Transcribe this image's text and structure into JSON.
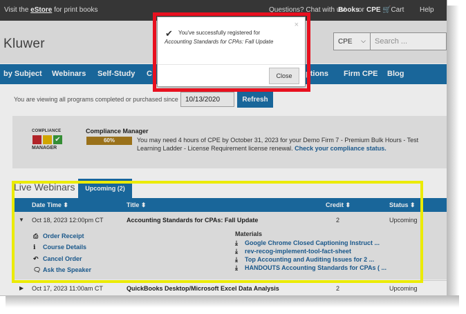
{
  "topbar": {
    "estore_pre": "Visit the ",
    "estore_link": "eStore",
    "estore_post": " for print books",
    "questions": "Questions? Chat with us!",
    "books": "Books",
    "or": "or",
    "cpe": "CPE",
    "cart": "Cart",
    "help": "Help"
  },
  "header": {
    "logo": "Kluwer",
    "cpe_select": "CPE",
    "search_placeholder": "Search ..."
  },
  "nav": {
    "items": [
      "by Subject",
      "Webinars",
      "Self-Study",
      "C",
      "ptions",
      "Firm CPE",
      "Blog"
    ]
  },
  "filter": {
    "label": "You are viewing all programs completed or purchased since",
    "date": "10/13/2020",
    "refresh": "Refresh"
  },
  "compliance": {
    "logo_top": "COMPLIANCE",
    "logo_bottom": "MANAGER",
    "title": "Compliance Manager",
    "progress": "60%",
    "progress_value": 0.6,
    "text": "You may need 4 hours of CPE by October 31, 2023 for your Demo Firm 7 - Premium Bulk Hours - Test Learning Ladder - License Requirement license renewal.",
    "link": "Check your compliance status."
  },
  "webinars": {
    "title": "Live Webinars",
    "tab": "Upcoming (2)",
    "columns": {
      "date": "Date Time ⬍",
      "title": "Title ⬍",
      "credit": "Credit ⬍",
      "status": "Status ⬍"
    },
    "rows": [
      {
        "date": "Oct 18, 2023 12:00pm CT",
        "title": "Accounting Standards for CPAs: Fall Update",
        "credit": "2",
        "status": "Upcoming",
        "actions": [
          "Order Receipt",
          "Course Details",
          "Cancel Order",
          "Ask the Speaker"
        ],
        "materials_label": "Materials",
        "materials": [
          "Google Chrome Closed Captioning Instruct ...",
          "rev-recog-implement-tool-fact-sheet",
          "Top Accounting and Auditing Issues for 2 ...",
          "HANDOUTS Accounting Standards for CPAs ( ..."
        ]
      },
      {
        "date": "Oct 17, 2023 11:00am CT",
        "title": "QuickBooks Desktop/Microsoft Excel Data Analysis",
        "credit": "2",
        "status": "Upcoming"
      }
    ]
  },
  "modal": {
    "message": "You've successfully registered for",
    "course": "Accounting Standards for CPAs: Fall Update",
    "close_button": "Close",
    "close_x": "×"
  },
  "colors": {
    "nav_blue": "#1c6fa8",
    "highlight_red": "#e8101f",
    "highlight_yellow": "#ffff00",
    "progress_gold": "#a87b1d"
  }
}
